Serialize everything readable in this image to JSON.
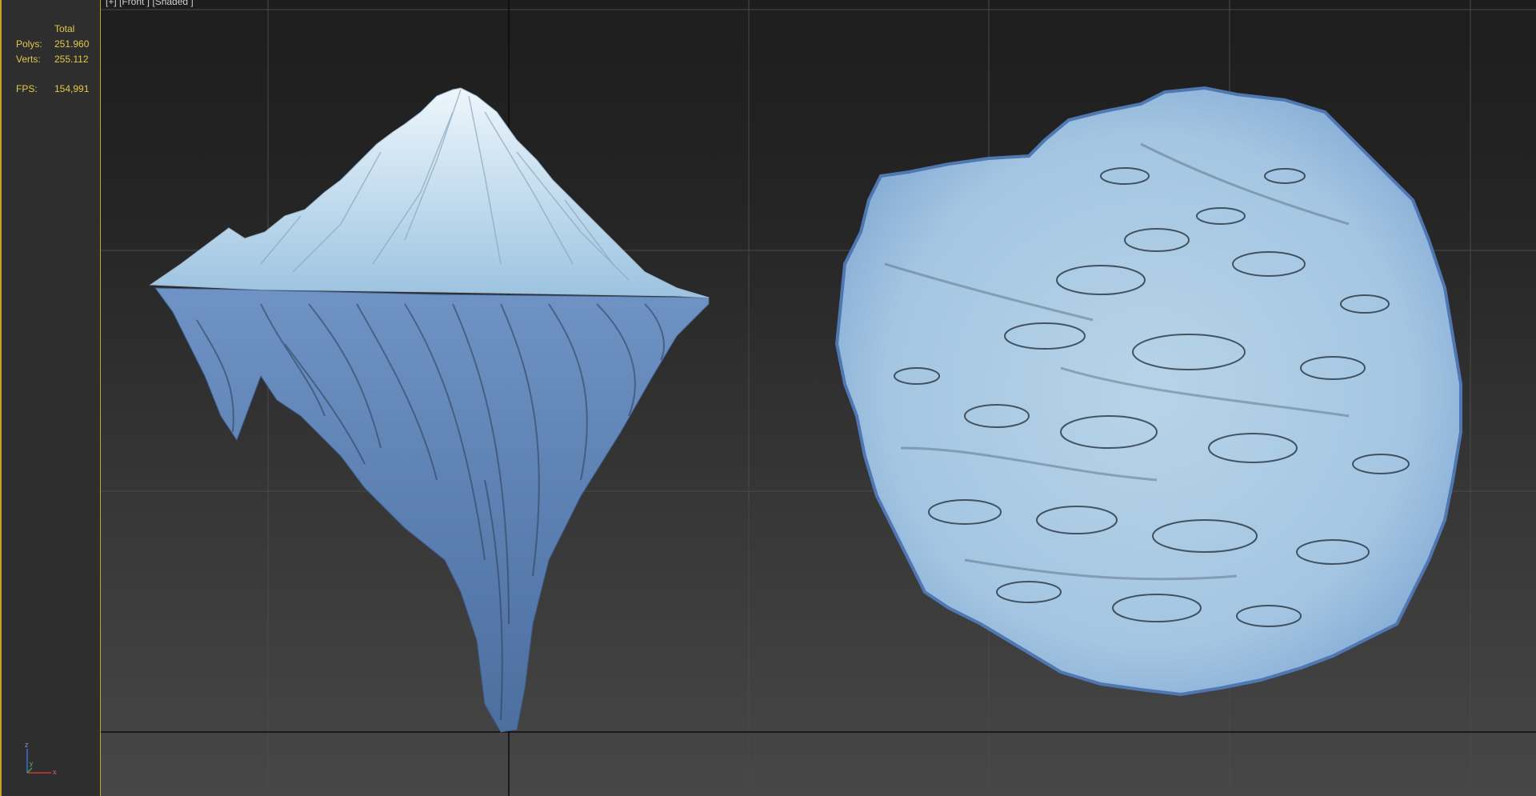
{
  "viewport": {
    "label": "[+] [Front ] [Shaded ]"
  },
  "stats": {
    "total_label": "Total",
    "polys_label": "Polys:",
    "polys_value": "251.960",
    "verts_label": "Verts:",
    "verts_value": "255.112",
    "fps_label": "FPS:",
    "fps_value": "154,991"
  },
  "axis_gizmo": {
    "z_label": "z",
    "x_label": "x",
    "y_label": "y"
  },
  "colors": {
    "stats_text": "#e3c84a",
    "panel_border": "#c9a227",
    "ice_light": "#cfe3f2",
    "ice_dark": "#5b7fb0"
  },
  "objects": [
    "iceberg-side-view",
    "iceberg-top-view"
  ]
}
